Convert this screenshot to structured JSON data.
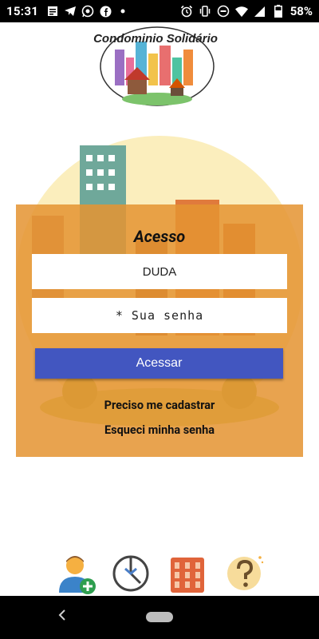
{
  "status_bar": {
    "time": "15:31",
    "battery": "58%",
    "left_icons": [
      "file-icon",
      "telegram-icon",
      "whatsapp-icon",
      "facebook-icon",
      "dot-icon"
    ],
    "right_icons": [
      "alarm-icon",
      "vibrate-icon",
      "dnd-icon",
      "wifi-icon",
      "signal-icon",
      "battery-icon"
    ]
  },
  "logo": {
    "title": "Condominio Solidário"
  },
  "login": {
    "title": "Acesso",
    "username_value": "DUDA",
    "password_placeholder": "* Sua senha",
    "access_button": "Acessar",
    "register_link": "Preciso me cadastrar",
    "forgot_link": "Esqueci minha senha"
  },
  "bottom_icons": [
    "add-user-icon",
    "clock-icon",
    "building-icon",
    "help-icon"
  ],
  "colors": {
    "panel": "#e49432",
    "button": "#4256c0",
    "status_bar": "#000000"
  }
}
